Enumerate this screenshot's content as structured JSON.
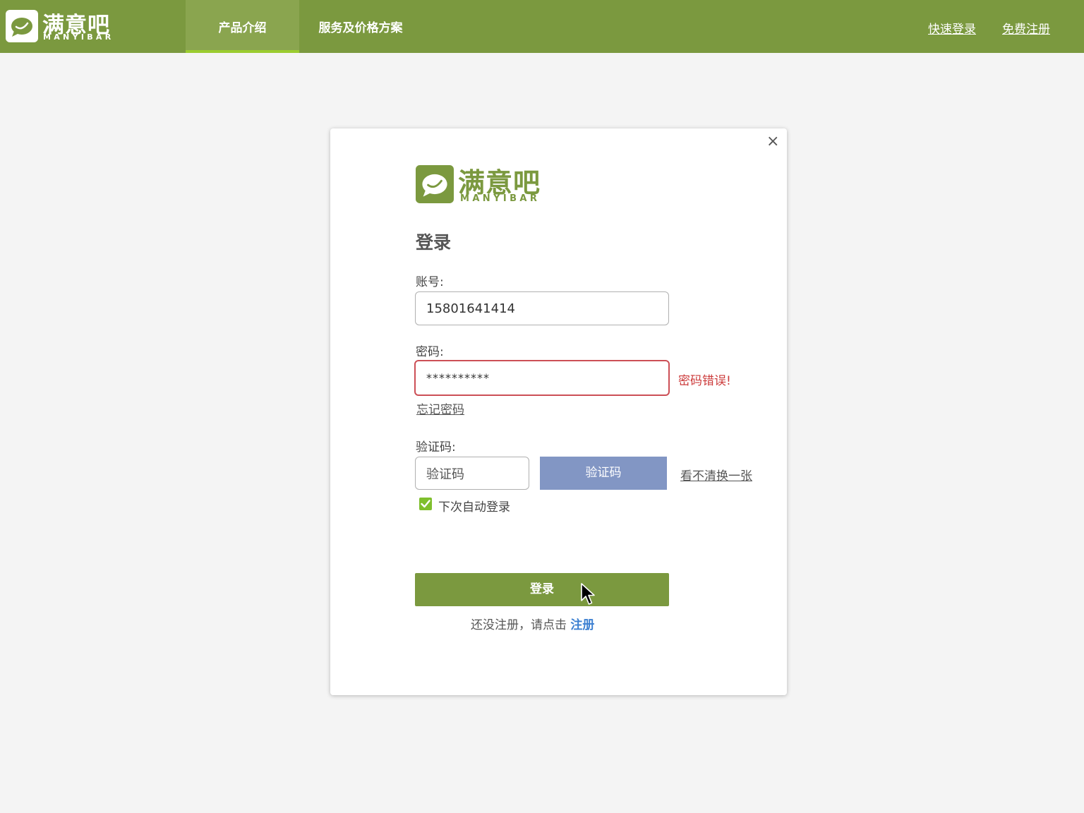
{
  "header": {
    "logo_cn": "满意吧",
    "logo_en": "MANYIBAR",
    "nav": [
      {
        "label": "产品介绍",
        "active": true
      },
      {
        "label": "服务及价格方案",
        "active": false
      }
    ],
    "links": {
      "quick_login": "快速登录",
      "free_register": "免费注册"
    }
  },
  "dialog": {
    "close_symbol": "×",
    "logo_cn": "满意吧",
    "logo_en": "MANYIBAR",
    "title": "登录",
    "account": {
      "label": "账号:",
      "value": "15801641414"
    },
    "password": {
      "label": "密码:",
      "value": "**********",
      "error": "密码错误!"
    },
    "forgot_password": "忘记密码",
    "captcha": {
      "label": "验证码:",
      "placeholder": "验证码",
      "image_text": "验证码",
      "refresh": "看不清换一张"
    },
    "remember": {
      "label": "下次自动登录",
      "checked": true
    },
    "login_button": "登录",
    "register_prompt": "还没注册，请点击",
    "register_link": "注册"
  },
  "colors": {
    "brand_green": "#7b993f",
    "nav_active_bg": "#8aa54f",
    "nav_active_underline": "#9bcc2f",
    "error_red": "#cc3b3b",
    "captcha_bg": "#8296c4",
    "link_blue": "#3b7fd1",
    "checkbox_green": "#7fbf2d"
  },
  "icons": {
    "logo": "speech-bubble-icon",
    "close": "close-icon",
    "checkbox": "checkmark-icon",
    "cursor": "mouse-pointer-icon"
  }
}
